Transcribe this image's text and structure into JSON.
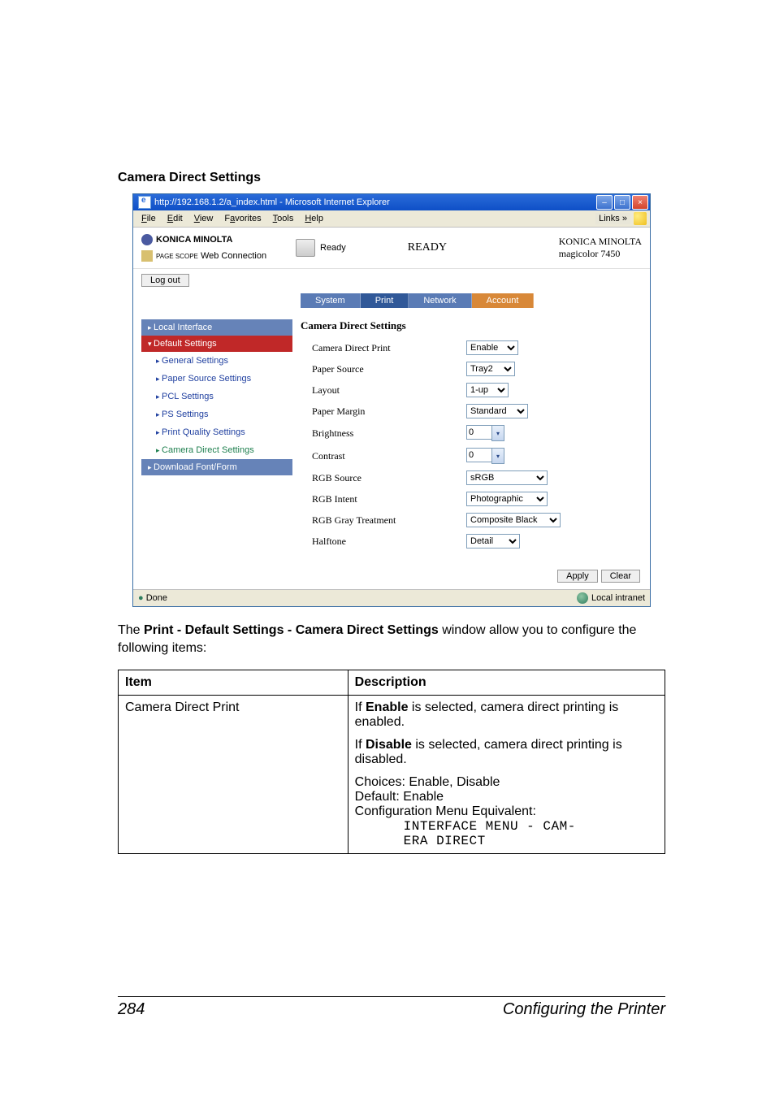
{
  "heading": "Camera Direct Settings",
  "browser": {
    "title": "http://192.168.1.2/a_index.html - Microsoft Internet Explorer",
    "menus": [
      "File",
      "Edit",
      "View",
      "Favorites",
      "Tools",
      "Help"
    ],
    "links_label": "Links",
    "header": {
      "brand": "KONICA MINOLTA",
      "connection": "Web Connection",
      "page_scope": "PAGE SCOPE",
      "ready_small": "Ready",
      "ready_big": "READY",
      "dev_brand": "KONICA MINOLTA",
      "dev_model": "magicolor 7450"
    },
    "logout": "Log out",
    "tabs": {
      "system": "System",
      "print": "Print",
      "network": "Network",
      "account": "Account"
    },
    "sidebar": {
      "local": "Local Interface",
      "default": "Default Settings",
      "items": [
        "General Settings",
        "Paper Source Settings",
        "PCL Settings",
        "PS Settings",
        "Print Quality Settings",
        "Camera Direct Settings"
      ],
      "download": "Download Font/Form"
    },
    "panel": {
      "title": "Camera Direct Settings",
      "rows": {
        "cdp": {
          "label": "Camera Direct Print",
          "value": "Enable"
        },
        "ps": {
          "label": "Paper Source",
          "value": "Tray2"
        },
        "lay": {
          "label": "Layout",
          "value": "1-up"
        },
        "pm": {
          "label": "Paper Margin",
          "value": "Standard"
        },
        "br": {
          "label": "Brightness",
          "value": "0"
        },
        "co": {
          "label": "Contrast",
          "value": "0"
        },
        "rs": {
          "label": "RGB Source",
          "value": "sRGB"
        },
        "ri": {
          "label": "RGB Intent",
          "value": "Photographic"
        },
        "rg": {
          "label": "RGB Gray Treatment",
          "value": "Composite Black"
        },
        "hf": {
          "label": "Halftone",
          "value": "Detail"
        }
      },
      "apply": "Apply",
      "clear": "Clear"
    },
    "status": {
      "done": "Done",
      "zone": "Local intranet"
    }
  },
  "para": {
    "prefix": "The ",
    "bold": "Print - Default Settings - Camera Direct Settings",
    "suffix": " window allow you to configure the following items:"
  },
  "table": {
    "head_item": "Item",
    "head_desc": "Description",
    "row1_item": "Camera Direct Print",
    "desc": {
      "p1a": "If ",
      "p1b": "Enable",
      "p1c": " is selected, camera direct printing is enabled.",
      "p2a": "If ",
      "p2b": "Disable",
      "p2c": " is selected, camera direct printing is disabled.",
      "p3_l1": "Choices: Enable, Disable",
      "p3_l2": "Default:  Enable",
      "p3_l3": "Configuration Menu Equivalent:",
      "p3_m1": "INTERFACE MENU - CAM-",
      "p3_m2": "ERA DIRECT"
    }
  },
  "footer": {
    "page": "284",
    "chapter": "Configuring the Printer"
  }
}
